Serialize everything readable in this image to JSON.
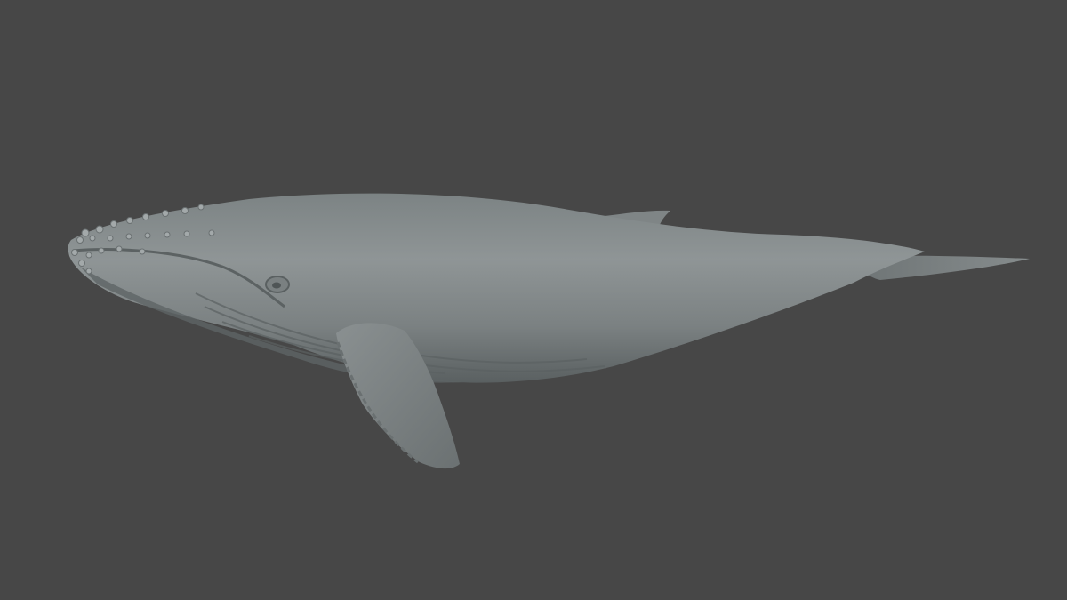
{
  "viewport": {
    "background_color": "#474747",
    "subject": "humpback-whale-model",
    "material_color": "#8a9091"
  }
}
